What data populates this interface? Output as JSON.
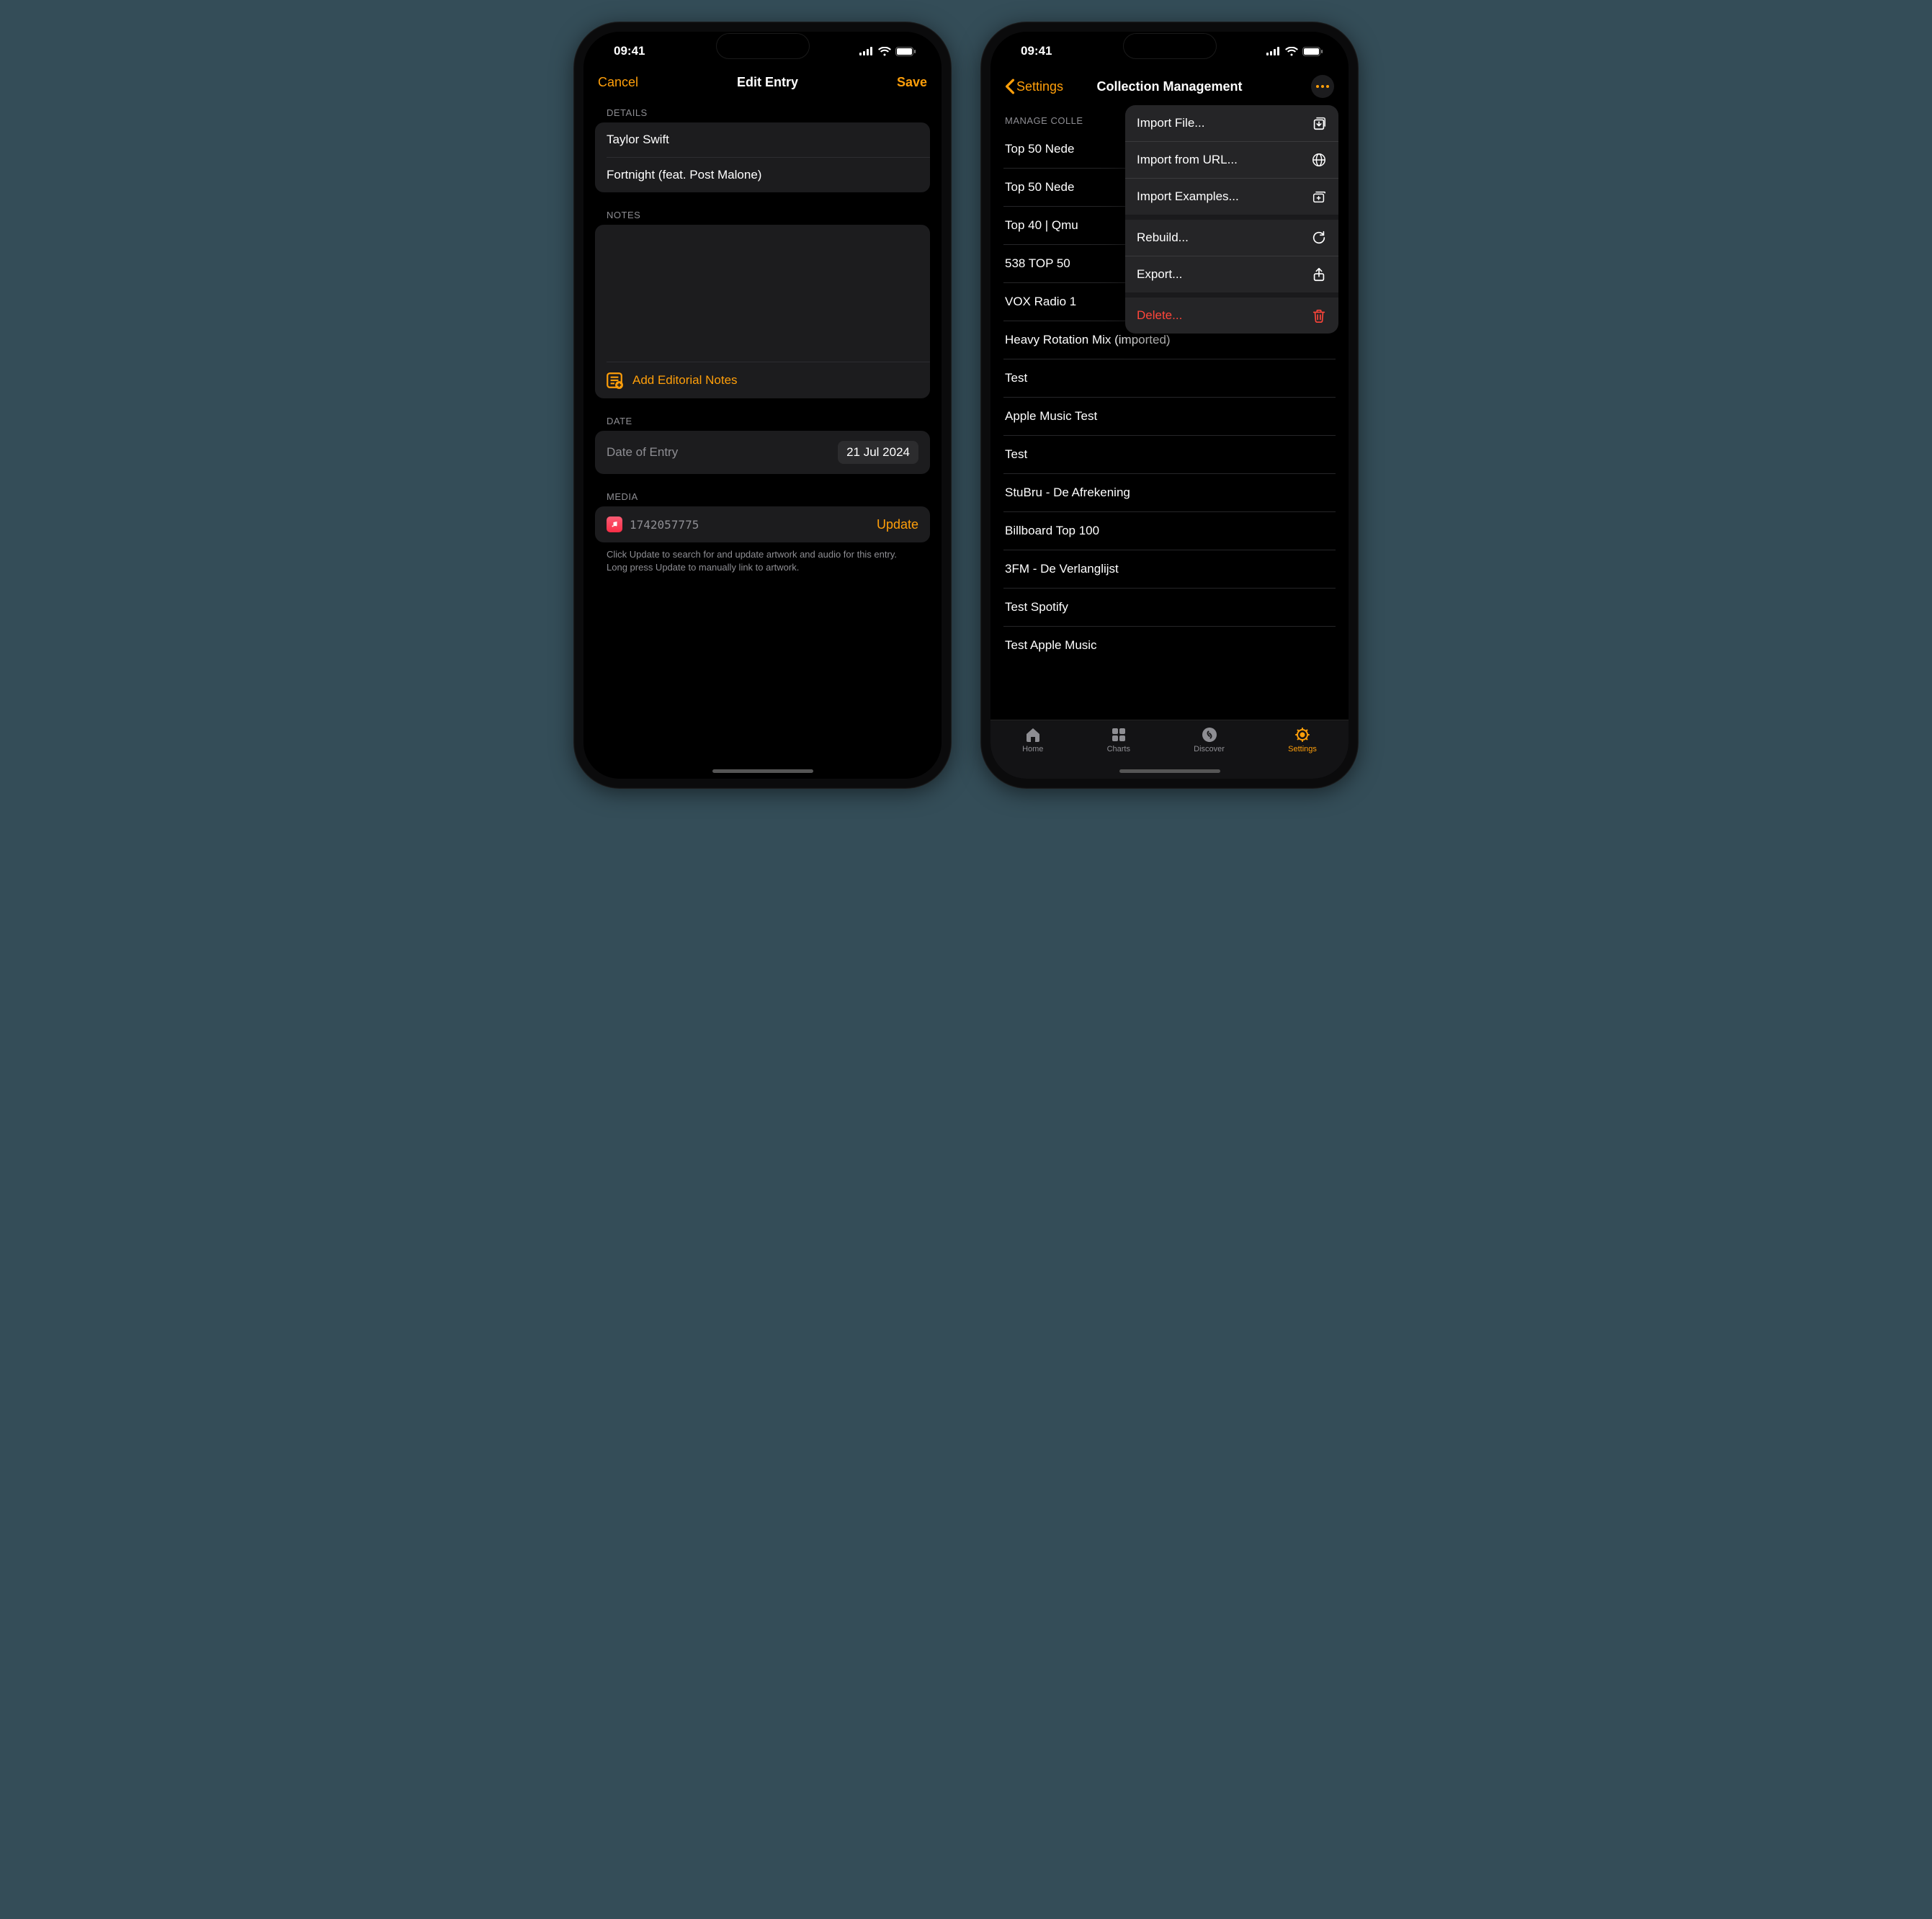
{
  "status": {
    "time": "09:41"
  },
  "left": {
    "cancel": "Cancel",
    "title": "Edit Entry",
    "save": "Save",
    "sections": {
      "details_hdr": "DETAILS",
      "artist": "Taylor Swift",
      "title": "Fortnight (feat. Post Malone)",
      "notes_hdr": "NOTES",
      "add_notes": "Add Editorial Notes",
      "date_hdr": "DATE",
      "date_label": "Date of Entry",
      "date_value": "21 Jul 2024",
      "media_hdr": "MEDIA",
      "media_id": "1742057775",
      "update": "Update",
      "media_hint": "Click Update to search for and update artwork and audio for this entry. Long press Update to manually link to artwork."
    }
  },
  "right": {
    "back": "Settings",
    "title": "Collection Management",
    "section_hdr": "MANAGE COLLE",
    "rows": [
      "Top 50 Nede",
      "Top 50 Nede",
      "Top 40 | Qmu",
      "538 TOP 50",
      "VOX Radio 1",
      "Heavy Rotation Mix (imported)",
      "Test",
      "Apple Music Test",
      "Test",
      "StuBru - De Afrekening",
      "Billboard Top 100",
      "3FM - De Verlanglijst",
      "Test Spotify",
      "Test Apple Music"
    ],
    "menu": {
      "import_file": "Import File...",
      "import_url": "Import from URL...",
      "import_examples": "Import Examples...",
      "rebuild": "Rebuild...",
      "export": "Export...",
      "delete": "Delete..."
    },
    "tabs": {
      "home": "Home",
      "charts": "Charts",
      "discover": "Discover",
      "settings": "Settings"
    }
  }
}
